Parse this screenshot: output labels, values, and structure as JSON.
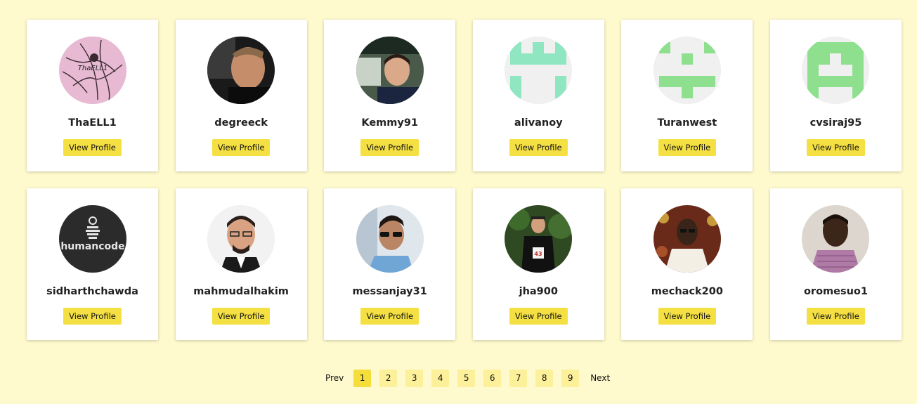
{
  "profiles": [
    {
      "username": "ThaELL1",
      "button_label": "View Profile",
      "avatar": "avatar-thaell1"
    },
    {
      "username": "degreeck",
      "button_label": "View Profile",
      "avatar": "avatar-degreeck"
    },
    {
      "username": "Kemmy91",
      "button_label": "View Profile",
      "avatar": "avatar-kemmy91"
    },
    {
      "username": "alivanoy",
      "button_label": "View Profile",
      "avatar": "identicon-avatar"
    },
    {
      "username": "Turanwest",
      "button_label": "View Profile",
      "avatar": "identicon-avatar"
    },
    {
      "username": "cvsiraj95",
      "button_label": "View Profile",
      "avatar": "identicon-avatar"
    },
    {
      "username": "sidharthchawda",
      "button_label": "View Profile",
      "avatar": "humancode-logo-avatar",
      "avatar_text": "humancode"
    },
    {
      "username": "mahmudalhakim",
      "button_label": "View Profile",
      "avatar": "avatar-mahmudalhakim"
    },
    {
      "username": "messanjay31",
      "button_label": "View Profile",
      "avatar": "avatar-messanjay31"
    },
    {
      "username": "jha900",
      "button_label": "View Profile",
      "avatar": "avatar-jha900"
    },
    {
      "username": "mechack200",
      "button_label": "View Profile",
      "avatar": "avatar-mechack200"
    },
    {
      "username": "oromesuo1",
      "button_label": "View Profile",
      "avatar": "avatar-oromesuo1"
    }
  ],
  "pagination": {
    "prev_label": "Prev",
    "next_label": "Next",
    "pages": [
      "1",
      "2",
      "3",
      "4",
      "5",
      "6",
      "7",
      "8",
      "9"
    ],
    "current_page": "1"
  },
  "colors": {
    "page_background": "#fffacd",
    "button": "#f5e043",
    "page_active": "#f5de3b",
    "page_inactive": "#fdf09a",
    "identicon_teal": "#8fe6c0",
    "identicon_green": "#8ee08e"
  }
}
